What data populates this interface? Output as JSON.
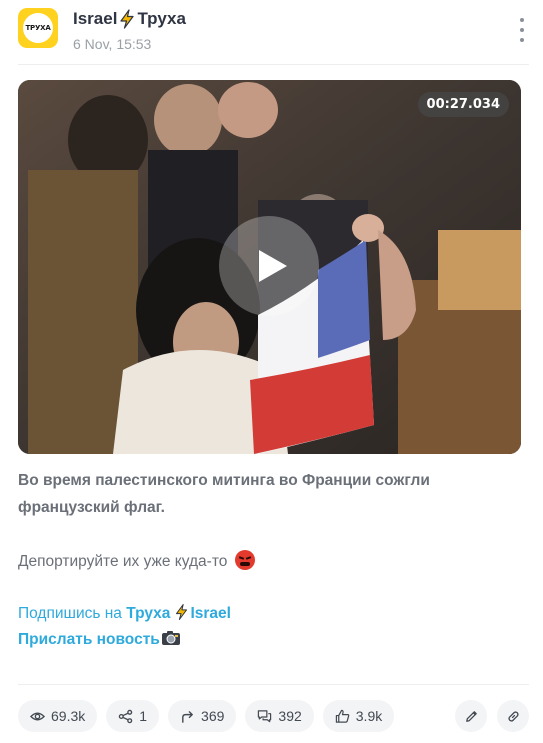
{
  "channel": {
    "avatar_text": "ТРУХА",
    "name_left": "Israel",
    "name_right": "Труха",
    "date": "6 Nov, 15:53"
  },
  "video": {
    "duration": "00:27.034"
  },
  "post": {
    "paragraph1": "Во время палестинского митинга во Франции сожгли французский флаг.",
    "paragraph2": "Депортируйте их уже куда-то",
    "subscribe_prefix": "Подпишись на ",
    "subscribe_channel_a": "Труха",
    "subscribe_channel_b": "Israel",
    "send_news": "Прислать новость"
  },
  "stats": {
    "views": "69.3k",
    "shares": "1",
    "forwards": "369",
    "comments": "392",
    "likes": "3.9k"
  },
  "icons": {
    "views": "eye-icon",
    "shares": "share-nodes-icon",
    "forwards": "forward-arrow-icon",
    "comments": "comments-icon",
    "likes": "thumbs-up-icon",
    "edit": "pencil-icon",
    "link": "link-icon"
  },
  "colors": {
    "link": "#2eaadc",
    "avatar_bg": "#ffd21f",
    "bolt": "#f5b800"
  }
}
